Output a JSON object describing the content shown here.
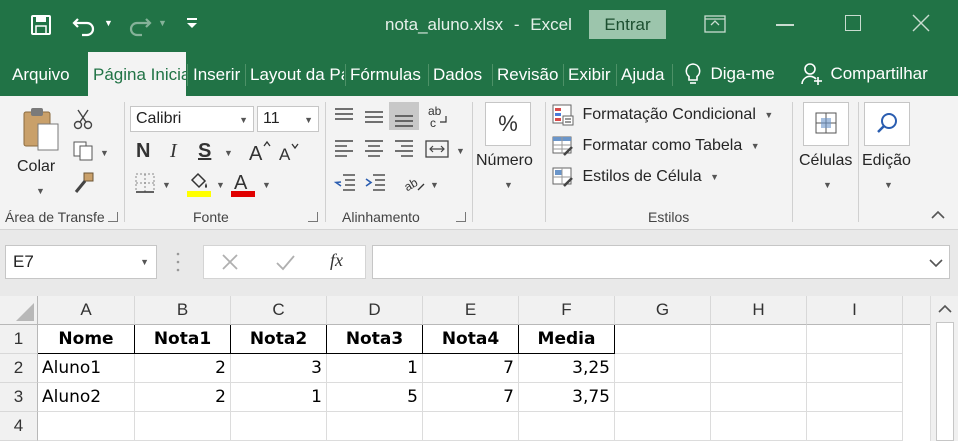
{
  "titlebar": {
    "filename": "nota_aluno.xlsx",
    "separator": "-",
    "app": "Excel",
    "signin": "Entrar"
  },
  "tabs": [
    "Arquivo",
    "Página Inicial",
    "Inserir",
    "Layout da Página",
    "Fórmulas",
    "Dados",
    "Revisão",
    "Exibir",
    "Ajuda"
  ],
  "tellme": "Diga-me",
  "share": "Compartilhar",
  "ribbon": {
    "clipboard": {
      "paste": "Colar",
      "group": "Área de Transferência"
    },
    "font": {
      "name": "Calibri",
      "size": "11",
      "bold": "N",
      "italic": "I",
      "underline": "S",
      "group": "Fonte"
    },
    "alignment": {
      "group": "Alinhamento",
      "wrap_glyph": "ab c"
    },
    "number": {
      "percent": "%",
      "label": "Número"
    },
    "styles": {
      "cond": "Formatação Condicional",
      "table": "Formatar como Tabela",
      "cell": "Estilos de Célula",
      "group": "Estilos"
    },
    "cells": {
      "label": "Células"
    },
    "editing": {
      "label": "Edição"
    }
  },
  "formula": {
    "namebox": "E7",
    "fx": "fx",
    "content": ""
  },
  "columns": [
    "A",
    "B",
    "C",
    "D",
    "E",
    "F",
    "G",
    "H",
    "I"
  ],
  "rows": [
    "1",
    "2",
    "3",
    "4"
  ],
  "sheet": {
    "header": [
      "Nome",
      "Nota1",
      "Nota2",
      "Nota3",
      "Nota4",
      "Media"
    ],
    "data": [
      [
        "Aluno1",
        "2",
        "3",
        "1",
        "7",
        "3,25"
      ],
      [
        "Aluno2",
        "2",
        "1",
        "5",
        "7",
        "3,75"
      ]
    ]
  },
  "colors": {
    "brand": "#217346",
    "font_highlight": "#ffff00",
    "font_color": "#e00000"
  }
}
